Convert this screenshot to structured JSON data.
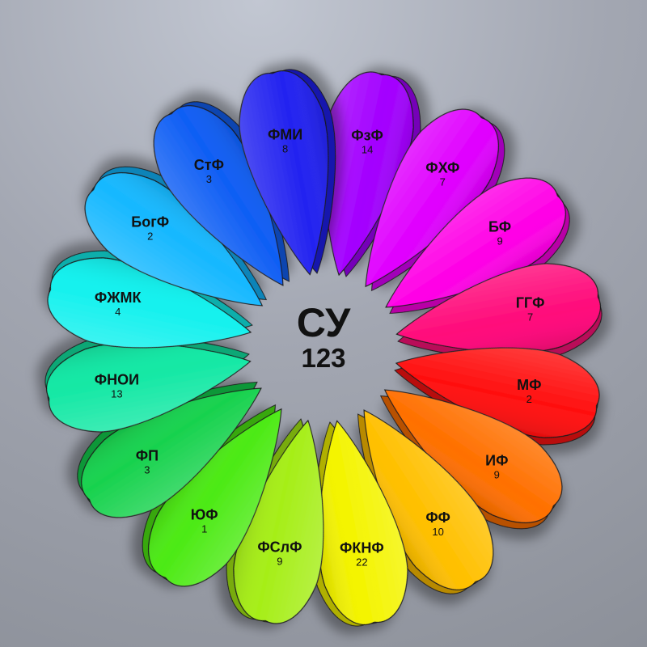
{
  "center": {
    "title": "СУ",
    "total": "123"
  },
  "petals": [
    {
      "name": "ФзФ",
      "count": "14",
      "color": "#a300ff"
    },
    {
      "name": "ФХФ",
      "count": "7",
      "color": "#e000ff"
    },
    {
      "name": "БФ",
      "count": "9",
      "color": "#ff00e6"
    },
    {
      "name": "ГГФ",
      "count": "7",
      "color": "#ff0a7a"
    },
    {
      "name": "МФ",
      "count": "2",
      "color": "#ff1010"
    },
    {
      "name": "ИФ",
      "count": "9",
      "color": "#ff7000"
    },
    {
      "name": "ФФ",
      "count": "10",
      "color": "#ffc000"
    },
    {
      "name": "ФКНФ",
      "count": "22",
      "color": "#f4f400"
    },
    {
      "name": "ФСлФ",
      "count": "9",
      "color": "#a6ee18"
    },
    {
      "name": "ЮФ",
      "count": "1",
      "color": "#4cea14"
    },
    {
      "name": "ФП",
      "count": "3",
      "color": "#18d24e"
    },
    {
      "name": "ФНОИ",
      "count": "13",
      "color": "#12e8a4"
    },
    {
      "name": "ФЖМК",
      "count": "4",
      "color": "#12f1ee"
    },
    {
      "name": "БогФ",
      "count": "2",
      "color": "#16b8ff"
    },
    {
      "name": "СтФ",
      "count": "3",
      "color": "#0f5ef4"
    },
    {
      "name": "ФМИ",
      "count": "8",
      "color": "#2323f0"
    }
  ]
}
